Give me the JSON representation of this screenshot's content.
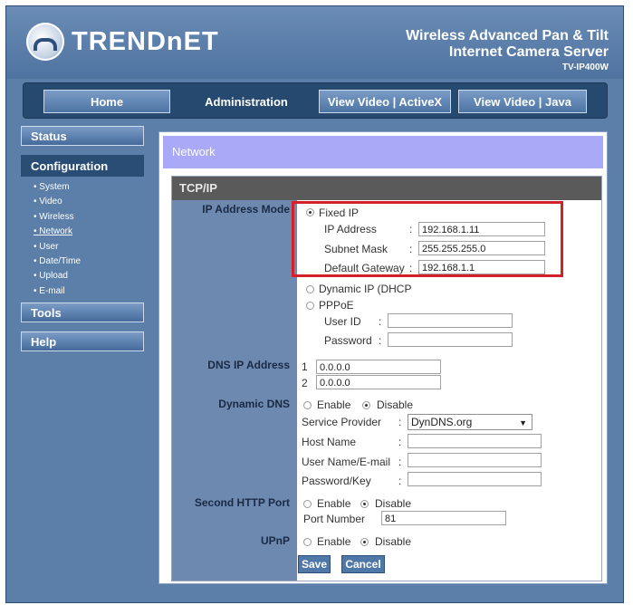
{
  "brand": {
    "name": "TRENDnET"
  },
  "product": {
    "line1": "Wireless Advanced Pan & Tilt",
    "line2": "Internet Camera Server",
    "model": "TV-IP400W"
  },
  "nav": {
    "home": "Home",
    "admin": "Administration",
    "view_activex": "View Video | ActiveX",
    "view_java": "View Video | Java"
  },
  "sidebar": {
    "status": "Status",
    "configuration": "Configuration",
    "sub": [
      "System",
      "Video",
      "Wireless",
      "Network",
      "User",
      "Date/Time",
      "Upload",
      "E-mail"
    ],
    "tools": "Tools",
    "help": "Help"
  },
  "page": {
    "title": "Network",
    "section": "TCP/IP"
  },
  "ip_mode": {
    "label": "IP Address Mode",
    "fixed_label": "Fixed IP",
    "ip_label": "IP Address",
    "ip_value": "192.168.1.11",
    "mask_label": "Subnet Mask",
    "mask_value": "255.255.255.0",
    "gw_label": "Default Gateway",
    "gw_value": "192.168.1.1",
    "dhcp_label": "Dynamic IP (DHCP",
    "pppoe_label": "PPPoE",
    "userid_label": "User ID",
    "password_label": "Password",
    "sep": ":"
  },
  "dns": {
    "label": "DNS IP Address",
    "n1": "1",
    "v1": "0.0.0.0",
    "n2": "2",
    "v2": "0.0.0.0"
  },
  "ddns": {
    "label": "Dynamic DNS",
    "enable": "Enable",
    "disable": "Disable",
    "provider_label": "Service Provider",
    "provider_value": "DynDNS.org",
    "host_label": "Host Name",
    "user_label": "User Name/E-mail",
    "key_label": "Password/Key"
  },
  "http2": {
    "label": "Second HTTP Port",
    "enable": "Enable",
    "disable": "Disable",
    "port_label": "Port Number",
    "port_value": "81"
  },
  "upnp": {
    "label": "UPnP",
    "enable": "Enable",
    "disable": "Disable"
  },
  "actions": {
    "save": "Save",
    "cancel": "Cancel"
  }
}
